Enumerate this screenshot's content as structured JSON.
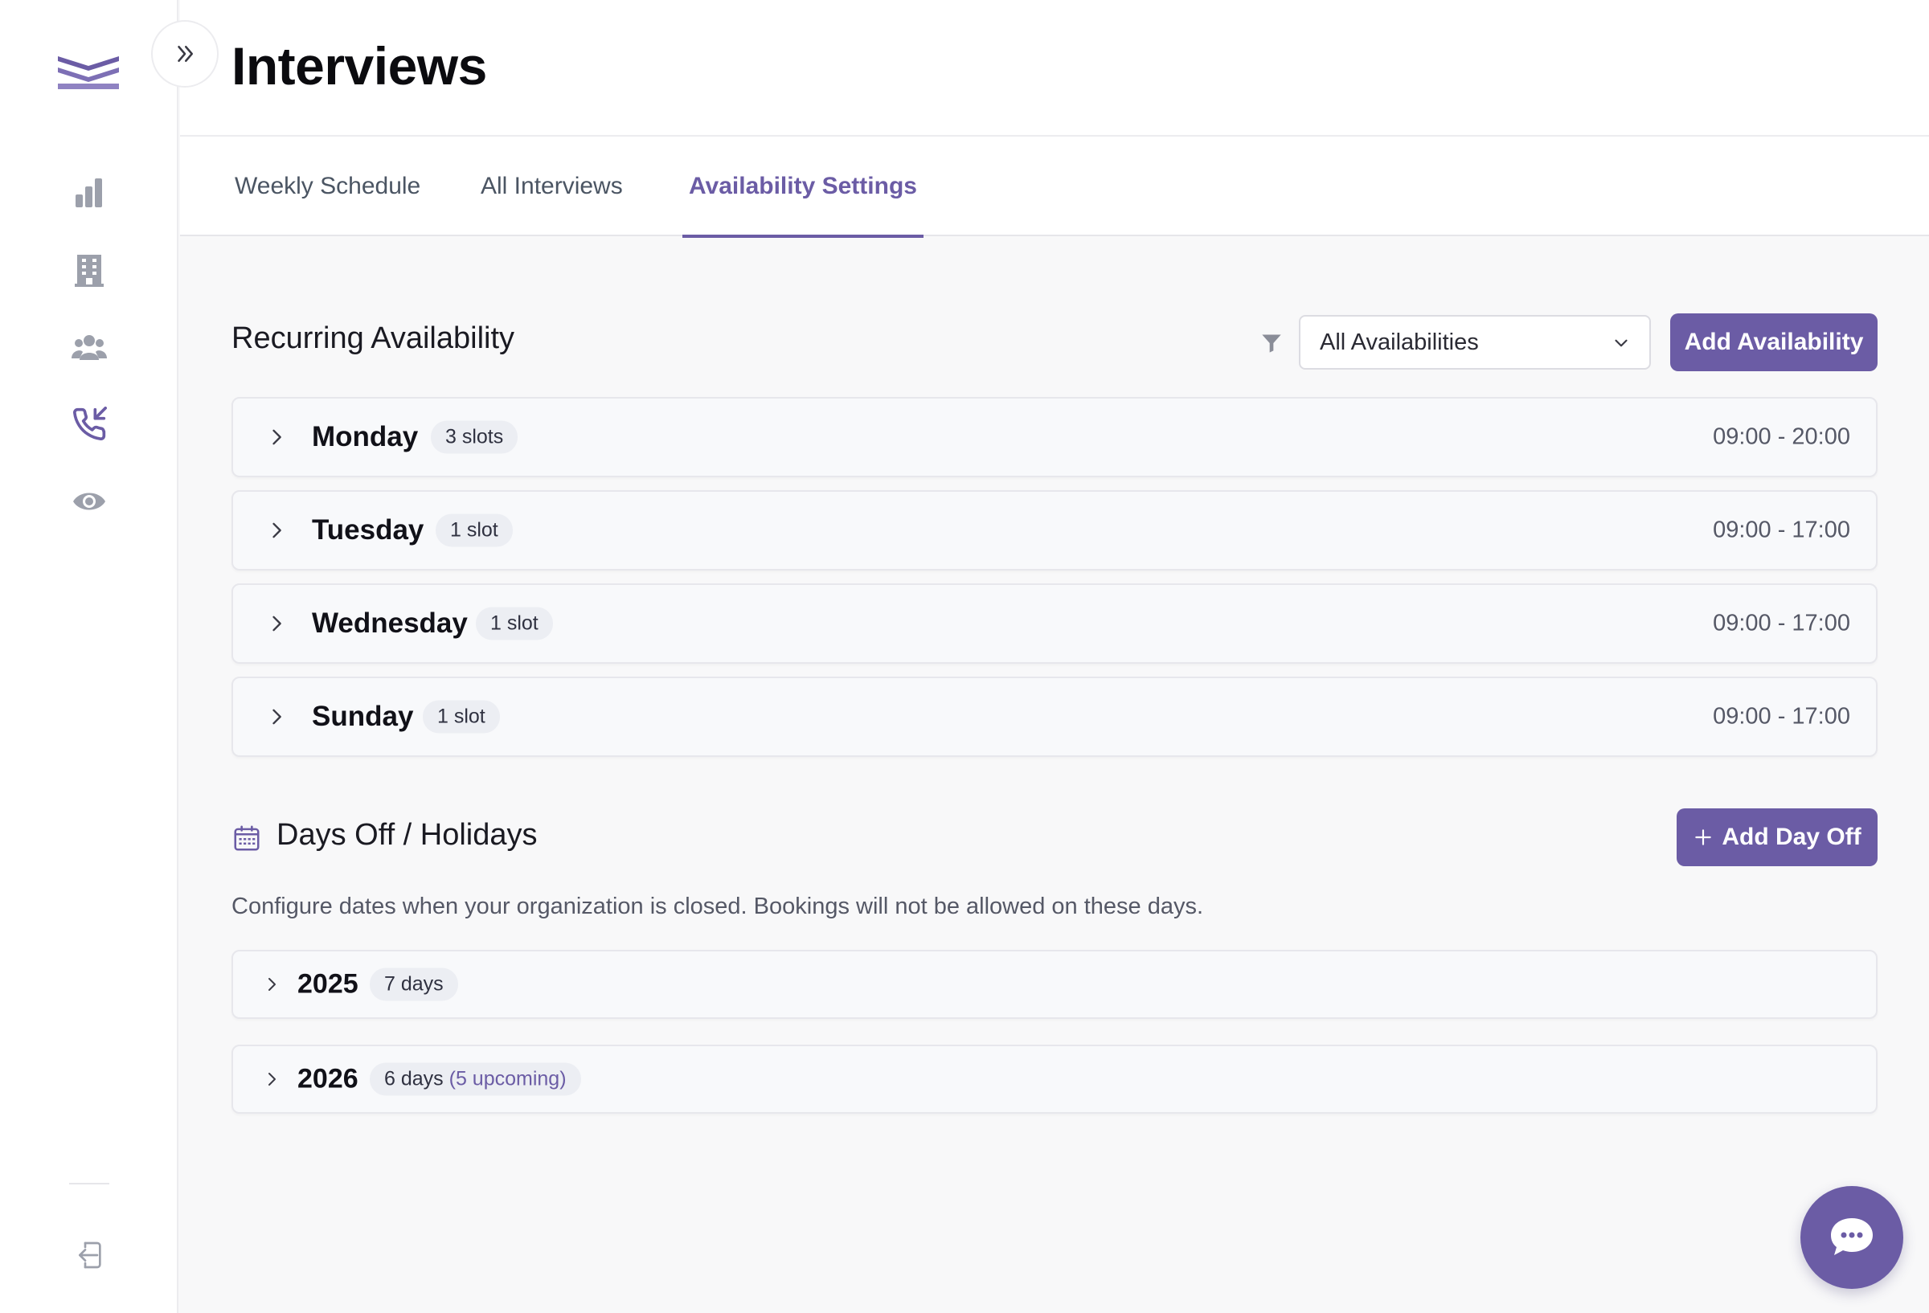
{
  "header": {
    "title": "Interviews"
  },
  "tabs": [
    {
      "label": "Weekly Schedule",
      "active": false
    },
    {
      "label": "All Interviews",
      "active": false
    },
    {
      "label": "Availability Settings",
      "active": true
    }
  ],
  "sidebar": {
    "icons": [
      "bar-chart-icon",
      "building-icon",
      "users-icon",
      "phone-incoming-icon",
      "eye-icon",
      "logout-icon"
    ]
  },
  "recurring": {
    "title": "Recurring Availability",
    "filter_value": "All Availabilities",
    "add_label": "Add Availability",
    "days": [
      {
        "day": "Monday",
        "slots": "3 slots",
        "time": "09:00 - 20:00"
      },
      {
        "day": "Tuesday",
        "slots": "1 slot",
        "time": "09:00 - 17:00"
      },
      {
        "day": "Wednesday",
        "slots": "1 slot",
        "time": "09:00 - 17:00"
      },
      {
        "day": "Sunday",
        "slots": "1 slot",
        "time": "09:00 - 17:00"
      }
    ]
  },
  "daysoff": {
    "title": "Days Off / Holidays",
    "add_label": "Add Day Off",
    "description": "Configure dates when your organization is closed. Bookings will not be allowed on these days.",
    "years": [
      {
        "year": "2025",
        "count": "7 days",
        "extra": ""
      },
      {
        "year": "2026",
        "count": "6 days",
        "extra": "(5 upcoming)"
      }
    ]
  },
  "colors": {
    "accent": "#6b5ca5",
    "text": "#111118",
    "muted": "#555866"
  }
}
